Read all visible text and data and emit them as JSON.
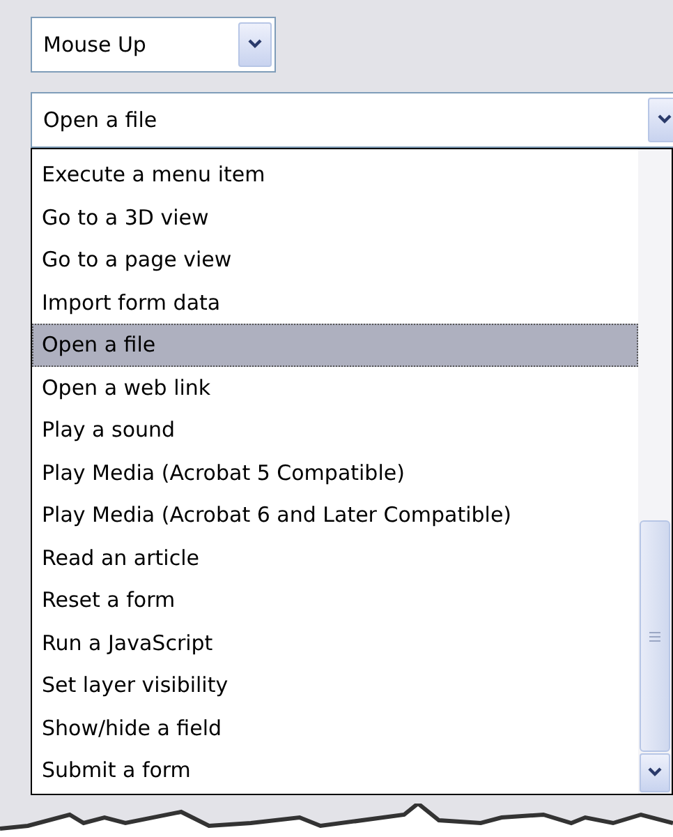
{
  "event_dropdown": {
    "value": "Mouse Up"
  },
  "action_dropdown": {
    "value": "Open a file",
    "expanded": true
  },
  "action_options": [
    {
      "label": "Execute a menu item",
      "selected": false
    },
    {
      "label": "Go to a 3D view",
      "selected": false
    },
    {
      "label": "Go to a page view",
      "selected": false
    },
    {
      "label": "Import form data",
      "selected": false
    },
    {
      "label": "Open a file",
      "selected": true
    },
    {
      "label": "Open a web link",
      "selected": false
    },
    {
      "label": "Play a sound",
      "selected": false
    },
    {
      "label": "Play Media (Acrobat 5 Compatible)",
      "selected": false
    },
    {
      "label": "Play Media (Acrobat 6 and Later Compatible)",
      "selected": false
    },
    {
      "label": "Read an article",
      "selected": false
    },
    {
      "label": "Reset a form",
      "selected": false
    },
    {
      "label": "Run a JavaScript",
      "selected": false
    },
    {
      "label": "Set layer visibility",
      "selected": false
    },
    {
      "label": "Show/hide a field",
      "selected": false
    },
    {
      "label": "Submit a form",
      "selected": false
    }
  ]
}
